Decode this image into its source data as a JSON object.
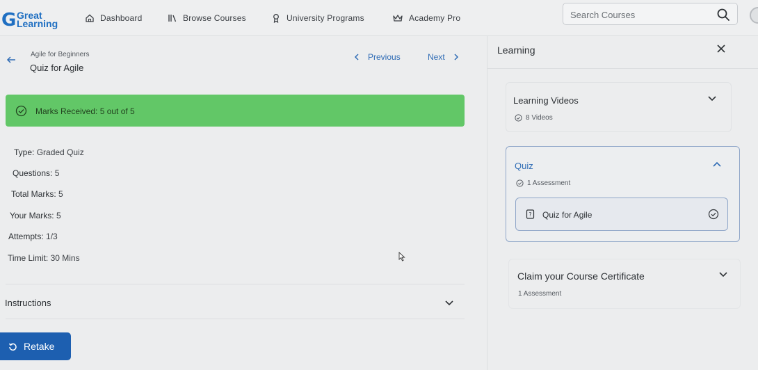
{
  "nav": {
    "logo_line1": "Great",
    "logo_line2": "Learning",
    "items": [
      {
        "label": "Dashboard",
        "icon": "home-icon"
      },
      {
        "label": "Browse Courses",
        "icon": "library-icon"
      },
      {
        "label": "University Programs",
        "icon": "award-icon"
      },
      {
        "label": "Academy Pro",
        "icon": "crown-icon"
      }
    ],
    "search_placeholder": "Search Courses"
  },
  "header": {
    "breadcrumb": "Agile for Beginners",
    "title": "Quiz for Agile",
    "previous_label": "Previous",
    "next_label": "Next"
  },
  "result": {
    "marks_text": "Marks Received: 5 out of 5"
  },
  "details": [
    {
      "label": "Type:",
      "value": "Graded Quiz"
    },
    {
      "label": "Questions:",
      "value": "5"
    },
    {
      "label": "Total Marks:",
      "value": "5"
    },
    {
      "label": "Your Marks:",
      "value": "5"
    },
    {
      "label": "Attempts:",
      "value": "1/3"
    },
    {
      "label": "Time Limit:",
      "value": "30 Mins"
    }
  ],
  "instructions_label": "Instructions",
  "retake_label": "Retake",
  "panel": {
    "title": "Learning",
    "sections": [
      {
        "title": "Learning Videos",
        "sub": "8 Videos"
      },
      {
        "title": "Quiz",
        "sub": "1 Assessment",
        "item": "Quiz for Agile"
      },
      {
        "title": "Claim your Course Certificate",
        "sub": "1 Assessment"
      }
    ]
  },
  "colors": {
    "accent": "#1d5fb0",
    "success": "#62c767",
    "link": "#2f6cb5"
  }
}
